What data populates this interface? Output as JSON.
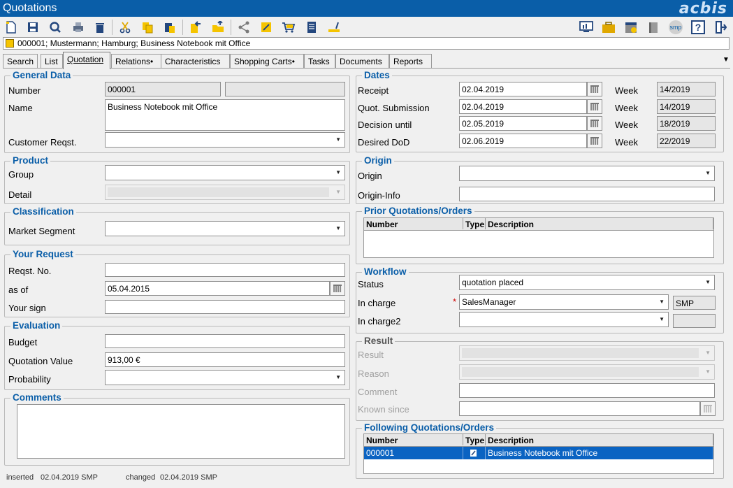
{
  "window": {
    "title": "Quotations",
    "logo": "acbis"
  },
  "record_bar": {
    "text": "000001; Mustermann; Hamburg; Business Notebook mit Office"
  },
  "tabs": [
    {
      "label": "Search"
    },
    {
      "label": "List"
    },
    {
      "label": "Quotation"
    },
    {
      "label": "Relations•"
    },
    {
      "label": "Characteristics"
    },
    {
      "label": "Shopping Carts•"
    },
    {
      "label": "Tasks"
    },
    {
      "label": "Documents"
    },
    {
      "label": "Reports"
    }
  ],
  "toolbar": {
    "smp_label": "smp"
  },
  "general": {
    "legend": "General Data",
    "number_label": "Number",
    "number_value": "000001",
    "number_extra": "",
    "name_label": "Name",
    "name_value": "Business Notebook mit Office",
    "customer_reqst_label": "Customer Reqst.",
    "customer_reqst_value": ""
  },
  "product": {
    "legend": "Product",
    "group_label": "Group",
    "group_value": "",
    "detail_label": "Detail"
  },
  "classification": {
    "legend": "Classification",
    "market_label": "Market Segment",
    "market_value": ""
  },
  "request": {
    "legend": "Your Request",
    "no_label": "Reqst. No.",
    "no_value": "",
    "asof_label": "as of",
    "asof_value": "05.04.2015",
    "sign_label": "Your sign",
    "sign_value": ""
  },
  "evaluation": {
    "legend": "Evaluation",
    "budget_label": "Budget",
    "budget_value": "",
    "qvalue_label": "Quotation Value",
    "qvalue_value": "913,00 €",
    "prob_label": "Probability",
    "prob_value": ""
  },
  "comments": {
    "legend": "Comments",
    "value": ""
  },
  "dates": {
    "legend": "Dates",
    "week_label": "Week",
    "rows": [
      {
        "label": "Receipt",
        "date": "02.04.2019",
        "week": "14/2019"
      },
      {
        "label": "Quot. Submission",
        "date": "02.04.2019",
        "week": "14/2019"
      },
      {
        "label": "Decision until",
        "date": "02.05.2019",
        "week": "18/2019"
      },
      {
        "label": "Desired DoD",
        "date": "02.06.2019",
        "week": "22/2019"
      }
    ]
  },
  "origin": {
    "legend": "Origin",
    "origin_label": "Origin",
    "origin_value": "",
    "info_label": "Origin-Info",
    "info_value": ""
  },
  "prior": {
    "legend": "Prior Quotations/Orders",
    "columns": [
      "Number",
      "Type",
      "Description"
    ]
  },
  "workflow": {
    "legend": "Workflow",
    "status_label": "Status",
    "status_value": "quotation placed",
    "incharge_label": "In charge",
    "incharge_value": "SalesManager",
    "incharge_code": "SMP",
    "incharge2_label": "In charge2",
    "incharge2_value": "",
    "incharge2_code": "",
    "required_mark": "*"
  },
  "result": {
    "legend": "Result",
    "result_label": "Result",
    "reason_label": "Reason",
    "comment_label": "Comment",
    "comment_value": "",
    "known_label": "Known since",
    "known_value": ""
  },
  "following": {
    "legend": "Following Quotations/Orders",
    "columns": [
      "Number",
      "Type",
      "Description"
    ],
    "rows": [
      {
        "number": "000001",
        "type": "",
        "description": "Business Notebook mit Office"
      }
    ]
  },
  "footer": {
    "inserted_label": "inserted",
    "inserted_value": "02.04.2019 SMP",
    "changed_label": "changed",
    "changed_value": "02.04.2019 SMP"
  }
}
